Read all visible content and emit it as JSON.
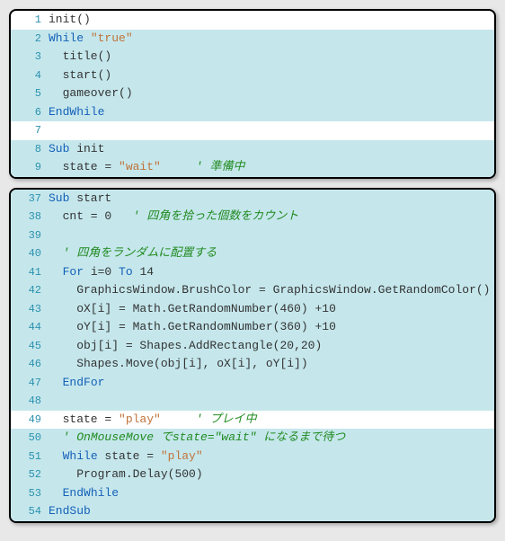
{
  "blocks": [
    {
      "lines": [
        {
          "num": 1,
          "hl": false,
          "tokens": [
            [
              "ident",
              "init"
            ],
            [
              "ident",
              "()"
            ]
          ]
        },
        {
          "num": 2,
          "hl": true,
          "tokens": [
            [
              "kw",
              "While"
            ],
            [
              "ident",
              " "
            ],
            [
              "str",
              "\"true\""
            ]
          ]
        },
        {
          "num": 3,
          "hl": true,
          "tokens": [
            [
              "ident",
              "  title()"
            ]
          ]
        },
        {
          "num": 4,
          "hl": true,
          "tokens": [
            [
              "ident",
              "  start()"
            ]
          ]
        },
        {
          "num": 5,
          "hl": true,
          "tokens": [
            [
              "ident",
              "  gameover()"
            ]
          ]
        },
        {
          "num": 6,
          "hl": true,
          "tokens": [
            [
              "kw",
              "EndWhile"
            ]
          ]
        },
        {
          "num": 7,
          "hl": false,
          "tokens": []
        },
        {
          "num": 8,
          "hl": true,
          "tokens": [
            [
              "kw",
              "Sub"
            ],
            [
              "ident",
              " init"
            ]
          ]
        },
        {
          "num": 9,
          "hl": true,
          "tokens": [
            [
              "ident",
              "  state = "
            ],
            [
              "str",
              "\"wait\""
            ],
            [
              "ident",
              "     "
            ],
            [
              "cmt",
              "' 準備中"
            ]
          ]
        }
      ]
    },
    {
      "lines": [
        {
          "num": 37,
          "hl": true,
          "tokens": [
            [
              "kw",
              "Sub"
            ],
            [
              "ident",
              " start"
            ]
          ]
        },
        {
          "num": 38,
          "hl": true,
          "tokens": [
            [
              "ident",
              "  cnt = "
            ],
            [
              "num",
              "0"
            ],
            [
              "ident",
              "   "
            ],
            [
              "cmt",
              "' 四角を拾った個数をカウント"
            ]
          ]
        },
        {
          "num": 39,
          "hl": true,
          "tokens": []
        },
        {
          "num": 40,
          "hl": true,
          "tokens": [
            [
              "ident",
              "  "
            ],
            [
              "cmt",
              "' 四角をランダムに配置する"
            ]
          ]
        },
        {
          "num": 41,
          "hl": true,
          "tokens": [
            [
              "ident",
              "  "
            ],
            [
              "kw",
              "For"
            ],
            [
              "ident",
              " i="
            ],
            [
              "num",
              "0"
            ],
            [
              "ident",
              " "
            ],
            [
              "kw",
              "To"
            ],
            [
              "ident",
              " "
            ],
            [
              "num",
              "14"
            ]
          ]
        },
        {
          "num": 42,
          "hl": true,
          "tokens": [
            [
              "ident",
              "    GraphicsWindow.BrushColor = GraphicsWindow.GetRandomColor()"
            ]
          ]
        },
        {
          "num": 43,
          "hl": true,
          "tokens": [
            [
              "ident",
              "    oX[i] = Math.GetRandomNumber("
            ],
            [
              "num",
              "460"
            ],
            [
              "ident",
              ") +"
            ],
            [
              "num",
              "10"
            ]
          ]
        },
        {
          "num": 44,
          "hl": true,
          "tokens": [
            [
              "ident",
              "    oY[i] = Math.GetRandomNumber("
            ],
            [
              "num",
              "360"
            ],
            [
              "ident",
              ") +"
            ],
            [
              "num",
              "10"
            ]
          ]
        },
        {
          "num": 45,
          "hl": true,
          "tokens": [
            [
              "ident",
              "    obj[i] = Shapes.AddRectangle("
            ],
            [
              "num",
              "20"
            ],
            [
              "ident",
              ","
            ],
            [
              "num",
              "20"
            ],
            [
              "ident",
              ")"
            ]
          ]
        },
        {
          "num": 46,
          "hl": true,
          "tokens": [
            [
              "ident",
              "    Shapes.Move(obj[i], oX[i], oY[i])"
            ]
          ]
        },
        {
          "num": 47,
          "hl": true,
          "tokens": [
            [
              "ident",
              "  "
            ],
            [
              "kw",
              "EndFor"
            ]
          ]
        },
        {
          "num": 48,
          "hl": true,
          "tokens": []
        },
        {
          "num": 49,
          "hl": false,
          "tokens": [
            [
              "ident",
              "  state = "
            ],
            [
              "str",
              "\"play\""
            ],
            [
              "ident",
              "     "
            ],
            [
              "cmt",
              "' プレイ中"
            ]
          ]
        },
        {
          "num": 50,
          "hl": true,
          "tokens": [
            [
              "ident",
              "  "
            ],
            [
              "cmt",
              "' OnMouseMove でstate=\"wait\" になるまで待つ"
            ]
          ]
        },
        {
          "num": 51,
          "hl": true,
          "tokens": [
            [
              "ident",
              "  "
            ],
            [
              "kw",
              "While"
            ],
            [
              "ident",
              " state = "
            ],
            [
              "str",
              "\"play\""
            ]
          ]
        },
        {
          "num": 52,
          "hl": true,
          "tokens": [
            [
              "ident",
              "    Program.Delay("
            ],
            [
              "num",
              "500"
            ],
            [
              "ident",
              ")"
            ]
          ]
        },
        {
          "num": 53,
          "hl": true,
          "tokens": [
            [
              "ident",
              "  "
            ],
            [
              "kw",
              "EndWhile"
            ]
          ]
        },
        {
          "num": 54,
          "hl": true,
          "tokens": [
            [
              "kw",
              "EndSub"
            ]
          ]
        }
      ]
    }
  ]
}
